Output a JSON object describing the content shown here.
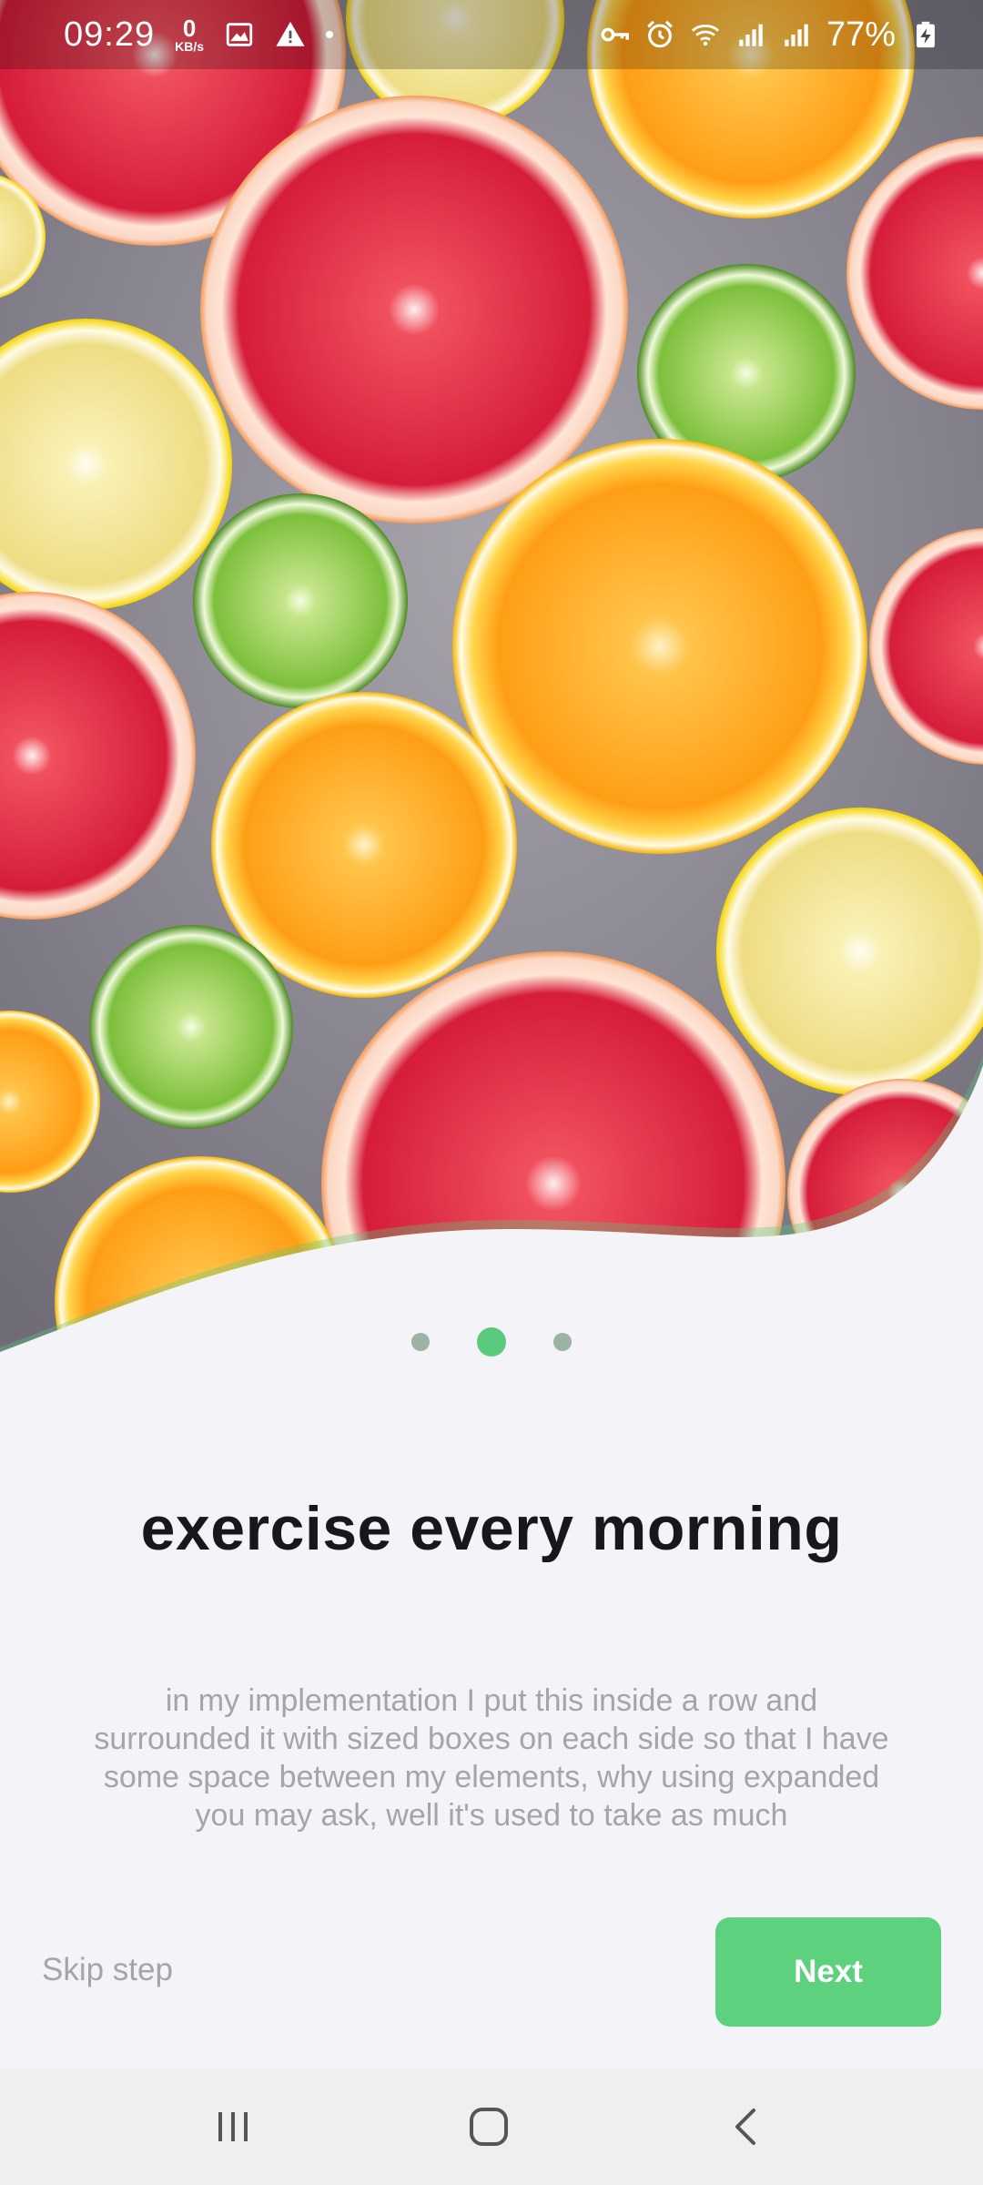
{
  "status_bar": {
    "time": "09:29",
    "network_speed_value": "0",
    "network_speed_unit": "KB/s",
    "battery": "77%",
    "icons_left": [
      "gallery-icon",
      "warning-icon",
      "notification-dot"
    ],
    "icons_right": [
      "vpn-key-icon",
      "alarm-icon",
      "wifi-icon",
      "signal-icon",
      "signal-icon",
      "battery-charging-icon"
    ]
  },
  "hero": {
    "image_subject": "citrus fruit slices",
    "curve_color": "#f3f3f8",
    "accent_color": "#5acb7c"
  },
  "pager": {
    "total": 3,
    "active_index": 1
  },
  "onboarding": {
    "title": "exercise every morning",
    "description": "in my implementation I put this inside a row and surrounded it with sized boxes on each side so that I have some space between my elements, why using expanded you may ask, well it's used to take as much"
  },
  "actions": {
    "skip_label": "Skip step",
    "next_label": "Next",
    "next_color": "#5ed17f"
  },
  "nav_bar": {
    "recents": "recents-icon",
    "home": "home-icon",
    "back": "back-icon"
  }
}
